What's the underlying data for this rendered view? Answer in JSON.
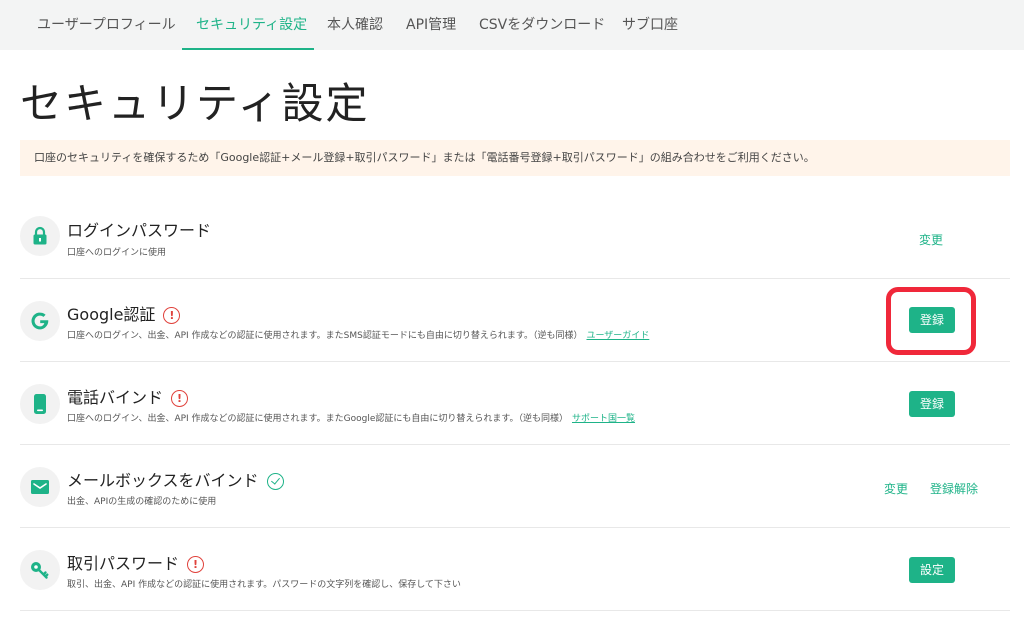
{
  "tabs": [
    {
      "label": "ユーザープロフィール"
    },
    {
      "label": "セキュリティ設定"
    },
    {
      "label": "本人確認"
    },
    {
      "label": "API管理"
    },
    {
      "label": "CSVをダウンロード"
    },
    {
      "label": "サブ口座"
    }
  ],
  "active_tab": "セキュリティ設定",
  "page_title": "セキュリティ設定",
  "notice": "口座のセキュリティを確保するため「Google認証+メール登録+取引パスワード」または「電話番号登録+取引パスワード」の組み合わせをご利用ください。",
  "colors": {
    "accent": "#1eb388",
    "warning": "#e0423c",
    "notice_bg": "#fff4ea",
    "highlight": "#f0283a"
  },
  "rows": [
    {
      "icon": "lock-icon",
      "title": "ログインパスワード",
      "status": "none",
      "desc": "口座へのログインに使用",
      "link": "",
      "actions": [
        "変更"
      ]
    },
    {
      "icon": "google-icon",
      "title": "Google認証",
      "status": "warning",
      "status_glyph": "!",
      "desc": "口座へのログイン、出金、API 作成などの認証に使用されます。またSMS認証モードにも自由に切り替えられます。（逆も同様）",
      "link": "ユーザーガイド",
      "actions": [
        "登録"
      ]
    },
    {
      "icon": "phone-icon",
      "title": "電話バインド",
      "status": "warning",
      "status_glyph": "!",
      "desc": "口座へのログイン、出金、API 作成などの認証に使用されます。またGoogle認証にも自由に切り替えられます。（逆も同様）",
      "link": "サポート国一覧",
      "actions": [
        "登録"
      ]
    },
    {
      "icon": "mail-icon",
      "title": "メールボックスをバインド",
      "status": "ok",
      "desc": "出金、APIの生成の確認のために使用",
      "link": "",
      "actions": [
        "変更",
        "登録解除"
      ]
    },
    {
      "icon": "key-icon",
      "title": "取引パスワード",
      "status": "warning",
      "status_glyph": "!",
      "desc": "取引、出金、API 作成などの認証に使用されます。パスワードの文字列を確認し、保存して下さい",
      "link": "",
      "actions": [
        "設定"
      ]
    }
  ]
}
